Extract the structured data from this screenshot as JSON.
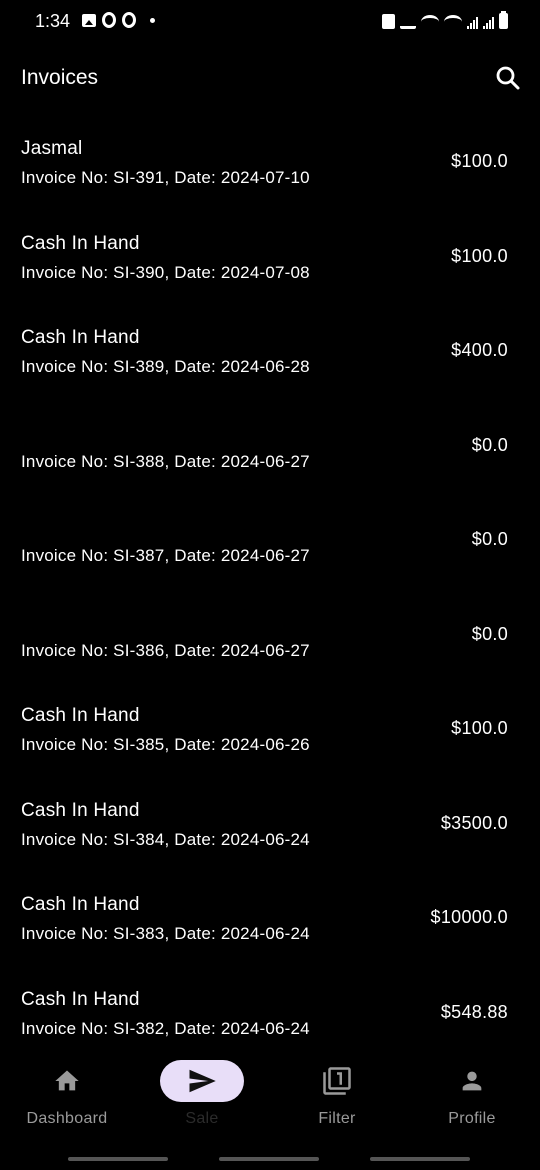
{
  "status_bar": {
    "time": "1:34",
    "left_icons": [
      "image-icon",
      "ring-icon",
      "ring-icon",
      "dot-icon"
    ],
    "right_icons": [
      "alarm-icon",
      "mute-icon",
      "wifi-icon",
      "wifi-call-icon",
      "signal-icon",
      "signal-icon",
      "battery-icon"
    ]
  },
  "header": {
    "title": "Invoices",
    "search_icon": "search-icon"
  },
  "invoices": [
    {
      "customer": "Jasmal",
      "meta": "Invoice No: SI-391, Date: 2024-07-10",
      "amount": "$100.0"
    },
    {
      "customer": "Cash In Hand",
      "meta": "Invoice No: SI-390, Date: 2024-07-08",
      "amount": "$100.0"
    },
    {
      "customer": "Cash In Hand",
      "meta": "Invoice No: SI-389, Date: 2024-06-28",
      "amount": "$400.0"
    },
    {
      "customer": "",
      "meta": "Invoice No: SI-388, Date: 2024-06-27",
      "amount": "$0.0"
    },
    {
      "customer": "",
      "meta": "Invoice No: SI-387, Date: 2024-06-27",
      "amount": "$0.0"
    },
    {
      "customer": "",
      "meta": "Invoice No: SI-386, Date: 2024-06-27",
      "amount": "$0.0"
    },
    {
      "customer": "Cash In Hand",
      "meta": "Invoice No: SI-385, Date: 2024-06-26",
      "amount": "$100.0"
    },
    {
      "customer": "Cash In Hand",
      "meta": "Invoice No: SI-384, Date: 2024-06-24",
      "amount": "$3500.0"
    },
    {
      "customer": "Cash In Hand",
      "meta": "Invoice No: SI-383, Date: 2024-06-24",
      "amount": "$10000.0"
    },
    {
      "customer": "Cash In Hand",
      "meta": "Invoice No: SI-382, Date: 2024-06-24",
      "amount": "$548.88"
    }
  ],
  "bottom_nav": {
    "items": [
      {
        "label": "Dashboard",
        "icon": "home-icon",
        "active": false
      },
      {
        "label": "Sale",
        "icon": "send-icon",
        "active": true
      },
      {
        "label": "Filter",
        "icon": "filter-icon",
        "active": false
      },
      {
        "label": "Profile",
        "icon": "person-icon",
        "active": false
      }
    ]
  },
  "colors": {
    "background": "#000000",
    "text": "#ffffff",
    "nav_inactive": "#9a9a9a",
    "active_pill": "#e8def8"
  }
}
